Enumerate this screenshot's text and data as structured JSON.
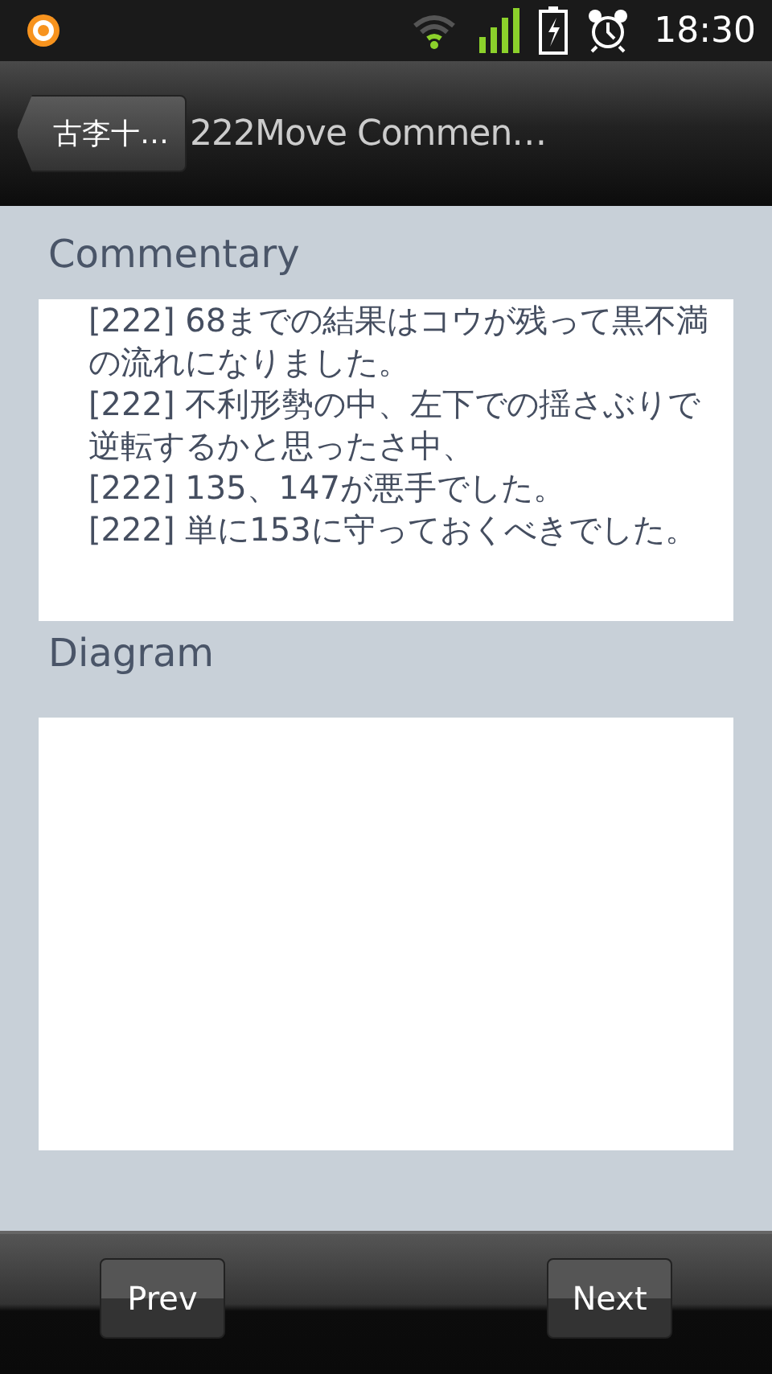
{
  "status_bar": {
    "time": "18:30"
  },
  "title_bar": {
    "back_label": "古李十…",
    "title": "222Move Commen…"
  },
  "commentary": {
    "heading": "Commentary",
    "entries": [
      "[222] 68までの結果はコウが残って黒不満の流れになりました。",
      "[222] 不利形勢の中、左下での揺さぶりで逆転するかと思ったさ中、",
      "[222] 135、147が悪手でした。",
      "[222] 単に153に守っておくべきでした。"
    ]
  },
  "diagram": {
    "heading": "Diagram"
  },
  "buttons": [
    "Prev",
    "Next"
  ]
}
